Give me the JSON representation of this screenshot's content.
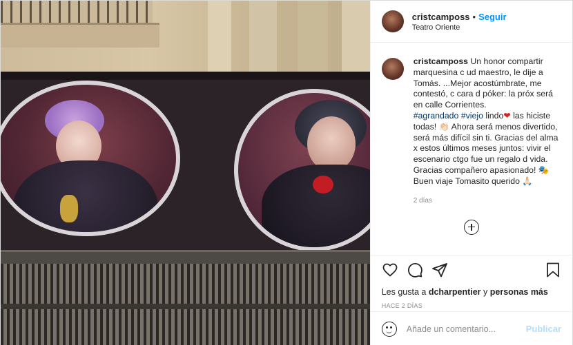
{
  "post": {
    "author": {
      "username": "cristcamposs",
      "follow_label": "Seguir",
      "separator": "•",
      "location": "Teatro Oriente"
    },
    "caption": {
      "username": "cristcamposs",
      "text_part1": "Un honor compartir marquesina c ud maestro, le dije a Tomás. ...Mejor acostúmbrate, me contestó, c cara d póker: la próx será en calle Corrientes.",
      "hashtag1": "#agrandado",
      "hashtag2": "#viejo",
      "text_part2": "lindo",
      "heart_emoji": "❤",
      "text_part3": "las hiciste todas! 👏🏻 Ahora será menos divertido, será más difícil sin ti. Gracias del alma x estos últimos meses juntos: vivir el escenario ctgo fue un regalo d vida. Gracias compañero apasionado! 🎭 Buen viaje Tomasito querido 🙏🏻",
      "age": "2 días"
    },
    "likes": {
      "prefix": "Les gusta a",
      "user": "dcharpentier",
      "connector": "y",
      "others": "personas más"
    },
    "date": "HACE 2 DÍAS",
    "comment_input": {
      "placeholder": "Añade un comentario..."
    },
    "publish_label": "Publicar"
  },
  "icons": {
    "like": "heart-icon",
    "comment": "comment-icon",
    "share": "paper-plane-icon",
    "save": "bookmark-icon",
    "load_more": "plus-circle-icon",
    "emoji": "emoji-icon"
  },
  "colors": {
    "accent": "#0095f6",
    "publish_disabled": "#b2dffc",
    "hashtag": "#00376b",
    "muted": "#8e8e8e"
  }
}
